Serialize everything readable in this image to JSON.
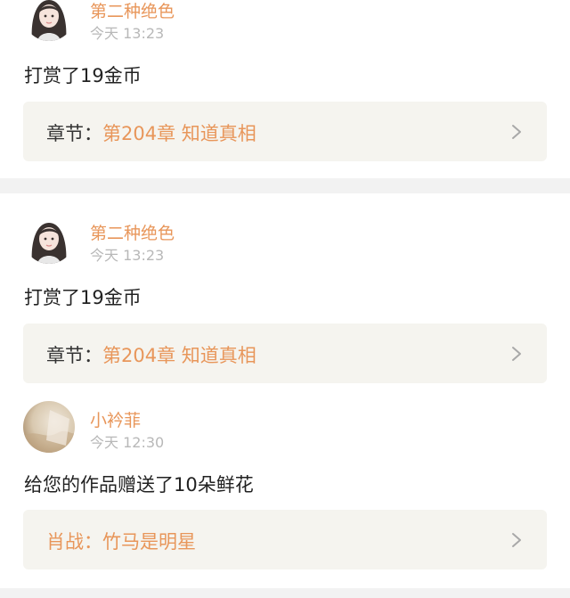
{
  "feed": {
    "items": [
      {
        "user_name": "第二种绝色",
        "time": "今天 13:23",
        "message": "打赏了19金币",
        "ref_prefix": "章节：",
        "ref_link": "第204章 知道真相"
      },
      {
        "user_name": "第二种绝色",
        "time": "今天 13:23",
        "message": "打赏了19金币",
        "ref_prefix": "章节：",
        "ref_link": "第204章 知道真相"
      },
      {
        "user_name": "小衿菲",
        "time": "今天 12:30",
        "message": "给您的作品赠送了10朵鲜花",
        "ref_text": "肖战：竹马是明星"
      }
    ]
  },
  "colors": {
    "accent": "#e8965a",
    "time_gray": "#b8b8b8",
    "ref_bg": "#f5f4ef",
    "separator": "#f2f2f2"
  },
  "icons": {
    "avatar_1": "girl-avatar-icon",
    "avatar_3": "photo-avatar-icon",
    "chevron": "chevron-right-icon"
  }
}
